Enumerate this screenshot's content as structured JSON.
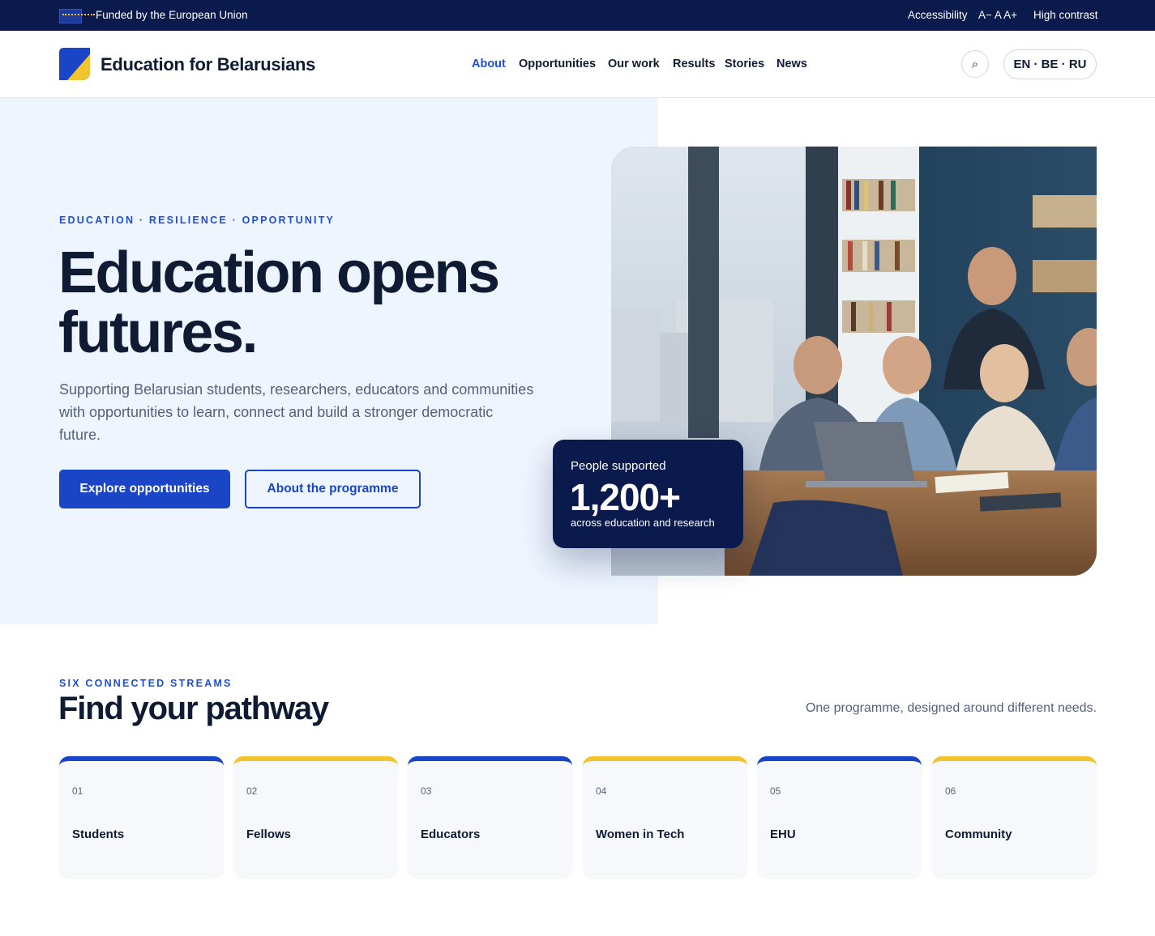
{
  "topbar": {
    "funded": "Funded by the European Union",
    "accessibility": "Accessibility",
    "font_size": "A− A A+",
    "contrast": "High contrast"
  },
  "header": {
    "logo_text": "Education for Belarusians",
    "nav": [
      {
        "label": "About",
        "active": true
      },
      {
        "label": "Opportunities",
        "active": false
      },
      {
        "label": "Our work",
        "active": false
      },
      {
        "label": "Results",
        "active": false
      },
      {
        "label": "Stories",
        "active": false
      },
      {
        "label": "News",
        "active": false
      }
    ],
    "search_icon": "⌕",
    "languages": "EN · BE · RU"
  },
  "hero": {
    "eyebrow": "EDUCATION · RESILIENCE · OPPORTUNITY",
    "title": "Education opens futures.",
    "subtitle": "Supporting Belarusian students, researchers, educators and communities with opportunities to learn, connect and build a stronger democratic future.",
    "primary_cta": "Explore opportunities",
    "secondary_cta": "About the programme",
    "stat": {
      "label": "People supported",
      "value": "1,200+",
      "caption": "across education and research"
    }
  },
  "pathways": {
    "eyebrow": "SIX CONNECTED STREAMS",
    "title": "Find your pathway",
    "note": "One programme, designed around different needs.",
    "cards": [
      {
        "num": "01",
        "title": "Students",
        "accent": "blue"
      },
      {
        "num": "02",
        "title": "Fellows",
        "accent": "yellow"
      },
      {
        "num": "03",
        "title": "Educators",
        "accent": "blue"
      },
      {
        "num": "04",
        "title": "Women in Tech",
        "accent": "yellow"
      },
      {
        "num": "05",
        "title": "EHU",
        "accent": "blue"
      },
      {
        "num": "06",
        "title": "Community",
        "accent": "yellow"
      }
    ]
  },
  "colors": {
    "navy": "#0b1a4d",
    "primary_blue": "#1a45c7",
    "accent_yellow": "#f2c530",
    "hero_bg": "#eef5fe"
  }
}
